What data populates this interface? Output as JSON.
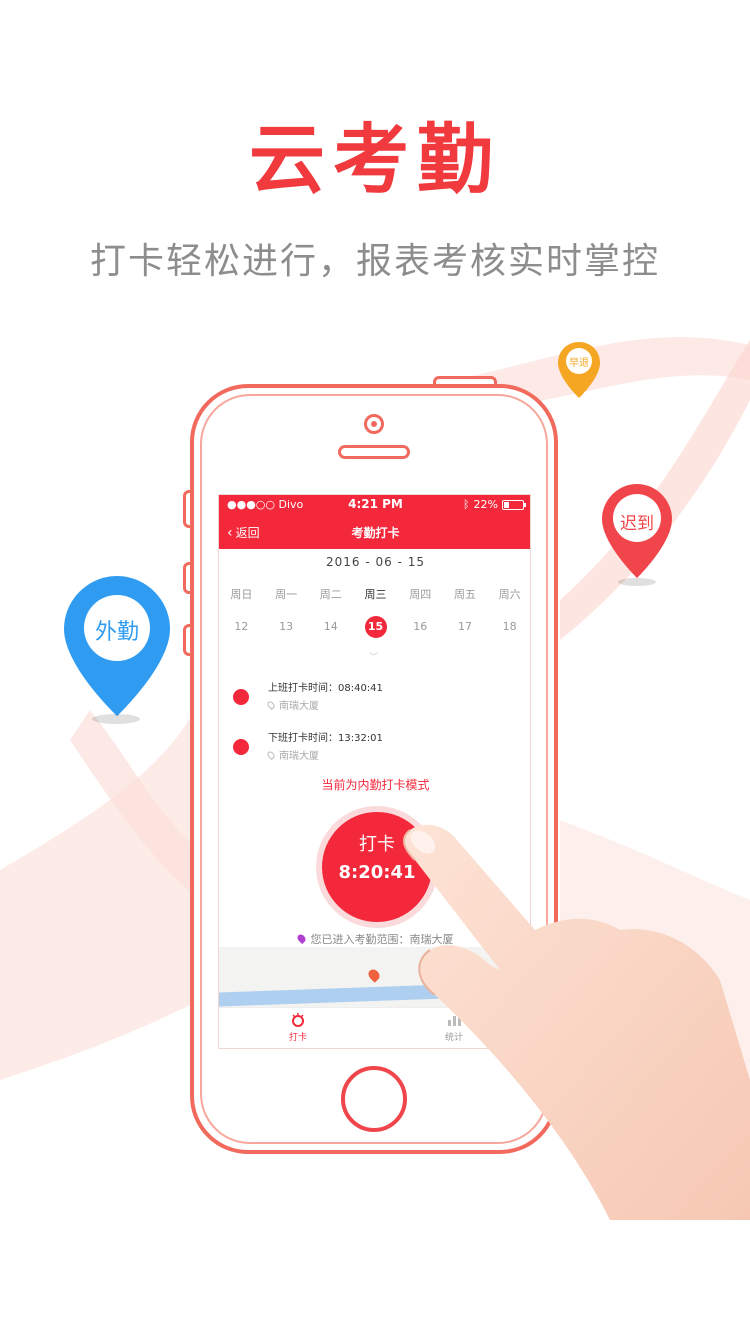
{
  "headline": "云考勤",
  "subtitle": "打卡轻松进行，报表考核实时掌控",
  "markers": {
    "field": "外勤",
    "late": "迟到",
    "early": "早退"
  },
  "phone": {
    "status": {
      "carrier": "●●●○○ Divo",
      "time": "4:21 PM",
      "battery": "22%"
    },
    "nav": {
      "back": "返回",
      "title": "考勤打卡"
    },
    "date": "2016 - 06 - 15",
    "weekdays": [
      "周日",
      "周一",
      "周二",
      "周三",
      "周四",
      "周五",
      "周六"
    ],
    "days": [
      "12",
      "13",
      "14",
      "15",
      "16",
      "17",
      "18"
    ],
    "records": [
      {
        "label": "上班打卡时间：08:40:41",
        "place": "南瑞大厦"
      },
      {
        "label": "下班打卡时间：13:32:01",
        "place": "南瑞大厦"
      }
    ],
    "mode": "当前为内勤打卡模式",
    "punch": {
      "label": "打卡",
      "time": "8:20:41"
    },
    "range": "您已进入考勤范围：南瑞大厦",
    "tabs": {
      "punch": "打卡",
      "stats": "统计"
    }
  },
  "colors": {
    "brand": "#f3283a",
    "field_pin": "#2f9cf2",
    "late_pin": "#f0454a",
    "early_pin": "#f5a623"
  },
  "icons": [
    "bluetooth-icon",
    "wifi-icon",
    "battery-icon",
    "back-chevron-icon",
    "location-pin-icon",
    "punch-tab-icon",
    "stats-tab-icon"
  ]
}
